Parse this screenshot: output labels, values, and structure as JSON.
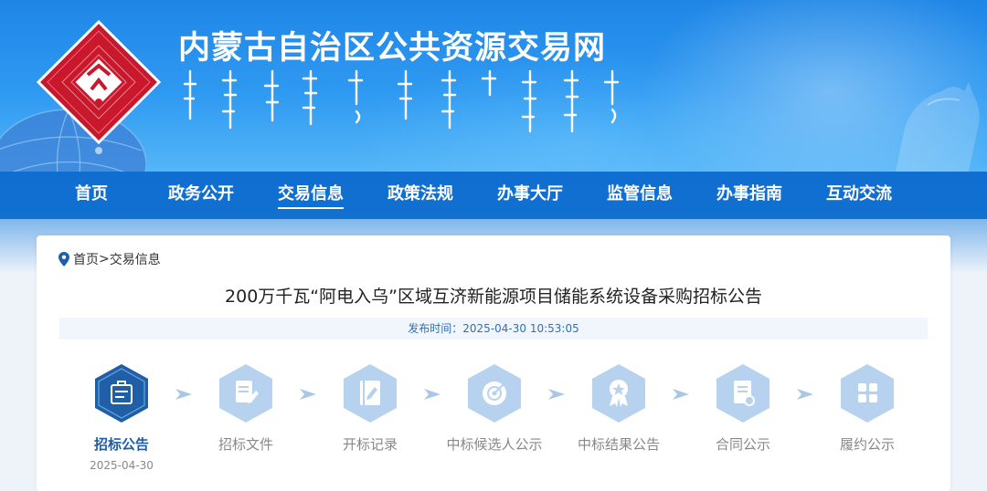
{
  "header": {
    "site_title": "内蒙古自治区公共资源交易网"
  },
  "nav": {
    "items": [
      "首页",
      "政务公开",
      "交易信息",
      "政策法规",
      "办事大厅",
      "监管信息",
      "办事指南",
      "互动交流"
    ],
    "active": "交易信息"
  },
  "breadcrumb": {
    "home": "首页",
    "separator": ">",
    "current": "交易信息"
  },
  "article": {
    "title": "200万千瓦“阿电入乌”区域互济新能源项目储能系统设备采购招标公告",
    "publish_label": "发布时间：",
    "publish_time": "2025-04-30 10:53:05"
  },
  "steps": [
    {
      "label": "招标公告",
      "date": "2025-04-30",
      "active": true,
      "icon": "announcement-icon"
    },
    {
      "label": "招标文件",
      "active": false,
      "icon": "document-edit-icon"
    },
    {
      "label": "开标记录",
      "active": false,
      "icon": "notebook-icon"
    },
    {
      "label": "中标候选人公示",
      "active": false,
      "icon": "target-icon"
    },
    {
      "label": "中标结果公告",
      "active": false,
      "icon": "award-icon"
    },
    {
      "label": "合同公示",
      "active": false,
      "icon": "contract-icon"
    },
    {
      "label": "履约公示",
      "active": false,
      "icon": "grid-icon"
    }
  ],
  "colors": {
    "banner": "#2f9af2",
    "nav": "#1170d0",
    "active_step": "#1e5fa8",
    "inactive_step": "#a9c8e8"
  }
}
